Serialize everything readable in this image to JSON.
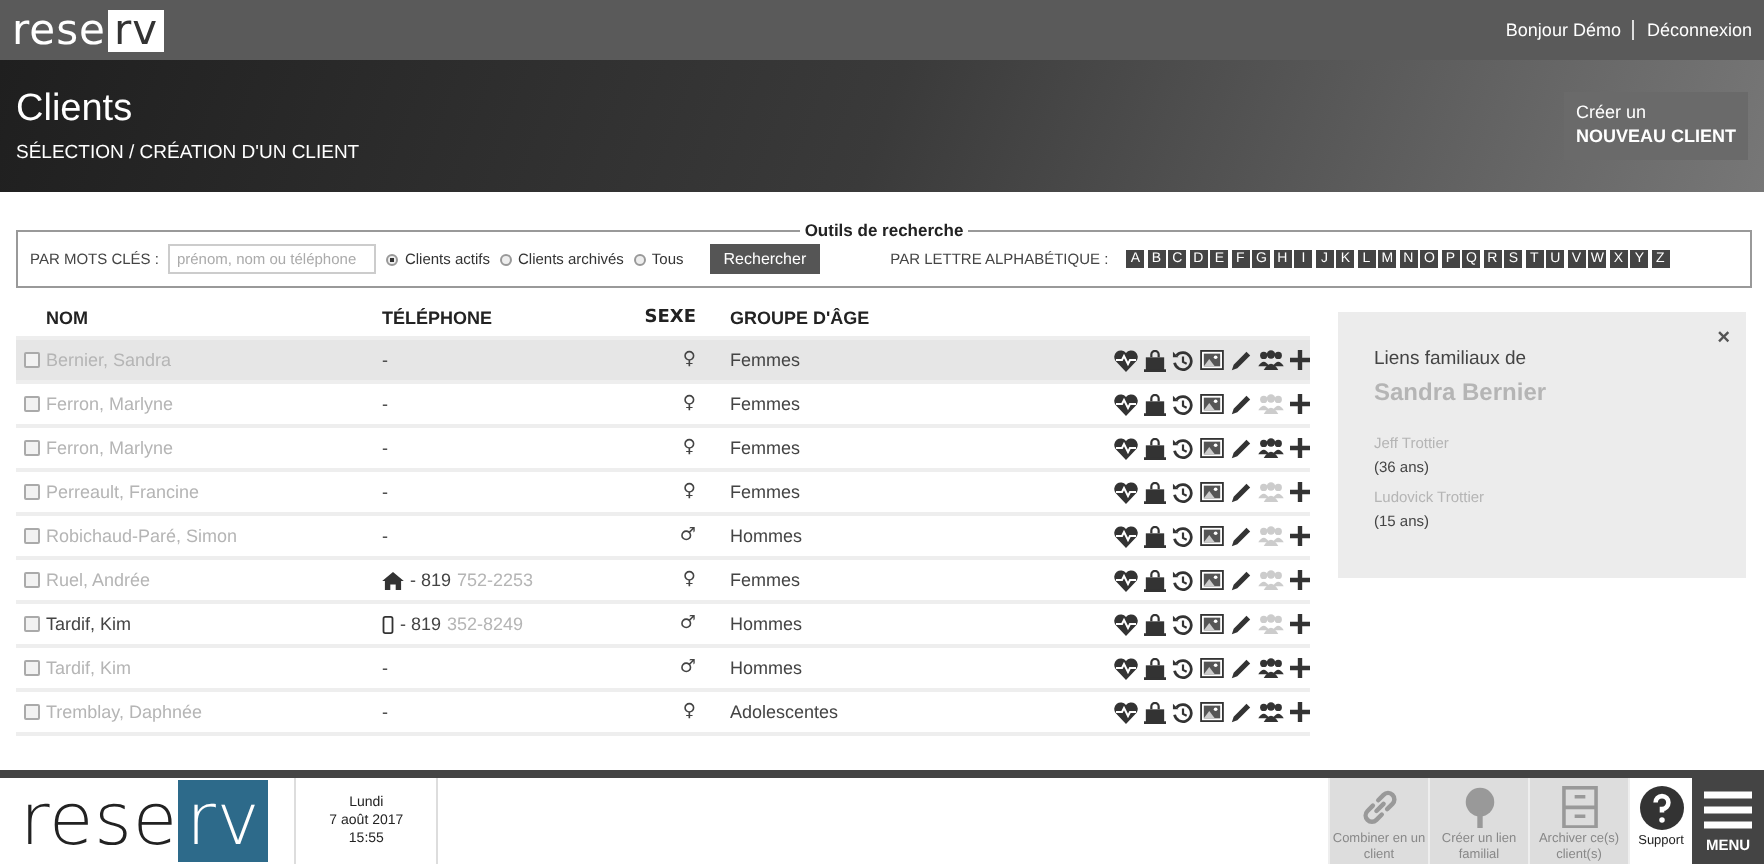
{
  "topbar": {
    "logo_left": "rese",
    "logo_right": "rv",
    "greeting": "Bonjour Démo",
    "logout": "Déconnexion"
  },
  "header": {
    "title": "Clients",
    "subtitle": "SÉLECTION / CRÉATION D'UN CLIENT",
    "create_line1": "Créer un",
    "create_line2": "NOUVEAU CLIENT"
  },
  "search": {
    "legend": "Outils de recherche",
    "keywords_label": "PAR MOTS CLÉS :",
    "placeholder": "prénom, nom ou téléphone",
    "filters": [
      {
        "label": "Clients actifs",
        "selected": true
      },
      {
        "label": "Clients archivés",
        "selected": false
      },
      {
        "label": "Tous",
        "selected": false
      }
    ],
    "button": "Rechercher",
    "letters_label": "PAR LETTRE ALPHABÉTIQUE :",
    "letters": [
      "A",
      "B",
      "C",
      "D",
      "E",
      "F",
      "G",
      "H",
      "I",
      "J",
      "K",
      "L",
      "M",
      "N",
      "O",
      "P",
      "Q",
      "R",
      "S",
      "T",
      "U",
      "V",
      "W",
      "X",
      "Y",
      "Z"
    ]
  },
  "table": {
    "columns": [
      "NOM",
      "TÉLÉPHONE",
      "SEXE",
      "GROUPE D'ÂGE"
    ],
    "rows": [
      {
        "name": "Bernier, Sandra",
        "blurred": true,
        "kind": "none",
        "phone": "-",
        "sex": "♀",
        "group": "Femmes",
        "family": true,
        "checked": false,
        "selected": true
      },
      {
        "name": "Ferron, Marlyne",
        "blurred": true,
        "kind": "none",
        "phone": "-",
        "sex": "♀",
        "group": "Femmes",
        "family": false,
        "checked": false,
        "selected": false
      },
      {
        "name": "Ferron, Marlyne",
        "blurred": true,
        "kind": "none",
        "phone": "-",
        "sex": "♀",
        "group": "Femmes",
        "family": true,
        "checked": false,
        "selected": false
      },
      {
        "name": "Perreault, Francine",
        "blurred": true,
        "kind": "none",
        "phone": "-",
        "sex": "♀",
        "group": "Femmes",
        "family": false,
        "checked": false,
        "selected": false
      },
      {
        "name": "Robichaud-Paré, Simon",
        "blurred": true,
        "kind": "none",
        "phone": "-",
        "sex": "♂",
        "group": "Hommes",
        "family": false,
        "checked": false,
        "selected": false
      },
      {
        "name": "Ruel, Andrée",
        "blurred": true,
        "kind": "home",
        "phone": "- 819",
        "phone_hidden": "752-2253",
        "sex": "♀",
        "group": "Femmes",
        "family": false,
        "checked": false,
        "selected": false
      },
      {
        "name": "Tardif, Kim",
        "blurred": false,
        "kind": "mobile",
        "phone": "- 819",
        "phone_hidden": "352-8249",
        "sex": "♂",
        "group": "Hommes",
        "family": false,
        "checked": false,
        "selected": false
      },
      {
        "name": "Tardif, Kim",
        "blurred": true,
        "kind": "none",
        "phone": "-",
        "sex": "♂",
        "group": "Hommes",
        "family": true,
        "checked": false,
        "selected": false
      },
      {
        "name": "Tremblay, Daphnée",
        "blurred": true,
        "kind": "none",
        "phone": "-",
        "sex": "♀",
        "group": "Adolescentes",
        "family": true,
        "checked": false,
        "selected": false
      }
    ]
  },
  "panel": {
    "close": "×",
    "title": "Liens familiaux de",
    "person": "Sandra Bernier",
    "members": [
      {
        "name": "Jeff Trottier",
        "age": "(36 ans)"
      },
      {
        "name": "Ludovick Trottier",
        "age": "(15 ans)"
      }
    ]
  },
  "footer": {
    "logo_left": "rese",
    "logo_right": "rv",
    "day": "Lundi",
    "date": "7 août 2017",
    "time": "15:55",
    "actions": [
      {
        "kind": "link",
        "label": "Combiner en un client",
        "disabled": true
      },
      {
        "kind": "tree",
        "label": "Créer un lien familial",
        "disabled": true
      },
      {
        "kind": "cabinet",
        "label": "Archiver ce(s) client(s)",
        "disabled": true
      },
      {
        "kind": "help",
        "label": "Support",
        "disabled": false
      }
    ],
    "menu": "MENU"
  }
}
